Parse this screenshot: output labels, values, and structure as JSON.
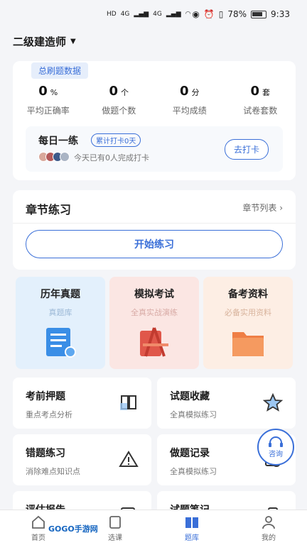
{
  "status_bar": {
    "left_labels": [
      "HD",
      "4G",
      "4G"
    ],
    "battery": "78%",
    "time": "9:33"
  },
  "header": {
    "title": "二级建造师"
  },
  "stats": {
    "tag": "总刷题数据",
    "items": [
      {
        "value": "0",
        "unit": "%",
        "label": "平均正确率"
      },
      {
        "value": "0",
        "unit": "个",
        "label": "做题个数"
      },
      {
        "value": "0",
        "unit": "分",
        "label": "平均成绩"
      },
      {
        "value": "0",
        "unit": "套",
        "label": "试卷套数"
      }
    ]
  },
  "daily": {
    "title": "每日一练",
    "badge": "累计打卡0天",
    "text": "今天已有0人完成打卡",
    "button": "去打卡"
  },
  "chapter": {
    "title": "章节练习",
    "link": "章节列表 ›",
    "start_button": "开始练习"
  },
  "tiles": [
    {
      "title": "历年真题",
      "sub": "真题库",
      "color": "#e3f0fc",
      "sub_color": "#9bb8d6"
    },
    {
      "title": "模拟考试",
      "sub": "全真实战演练",
      "color": "#fbe6e3",
      "sub_color": "#d8aaa5"
    },
    {
      "title": "备考资料",
      "sub": "必备实用资料",
      "color": "#fdeee4",
      "sub_color": "#d8b39c"
    }
  ],
  "grid": [
    {
      "title": "考前押题",
      "sub": "重点考点分析",
      "icon": "book-icon"
    },
    {
      "title": "试题收藏",
      "sub": "全真模拟练习",
      "icon": "star-icon"
    },
    {
      "title": "错题练习",
      "sub": "消除难点知识点",
      "icon": "warning-icon"
    },
    {
      "title": "做题记录",
      "sub": "全真模拟练习",
      "icon": "record-icon"
    },
    {
      "title": "评估报告",
      "sub": "",
      "icon": "report-icon"
    },
    {
      "title": "试题笔记",
      "sub": "",
      "icon": "note-icon"
    }
  ],
  "consult": {
    "label": "咨询"
  },
  "tabbar": [
    {
      "label": "首页",
      "active": false
    },
    {
      "label": "选课",
      "active": false
    },
    {
      "label": "题库",
      "active": true
    },
    {
      "label": "我的",
      "active": false
    }
  ],
  "watermark": "GOGO手游网",
  "colors": {
    "accent": "#3a6fd8",
    "background": "#f4f5f8"
  }
}
